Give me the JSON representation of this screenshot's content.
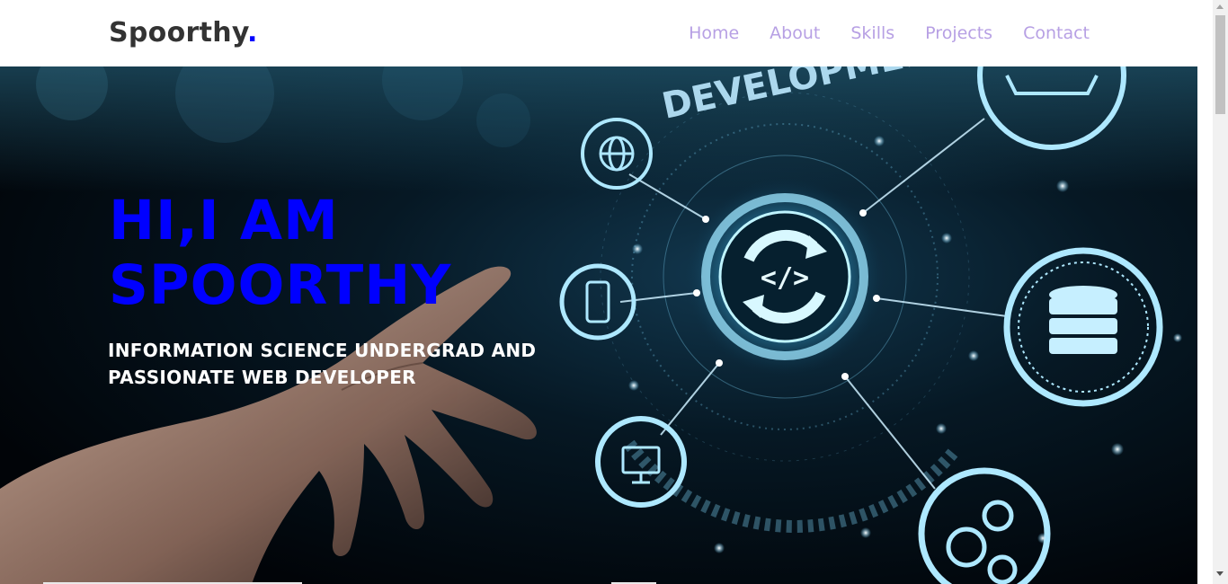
{
  "brand": {
    "name": "Spoorthy",
    "dot": "."
  },
  "nav": {
    "items": [
      {
        "label": "Home"
      },
      {
        "label": "About"
      },
      {
        "label": "Skills"
      },
      {
        "label": "Projects"
      },
      {
        "label": "Contact"
      }
    ]
  },
  "hero": {
    "title_line1": "HI,I AM",
    "title_line2": "SPOORTHY",
    "subtitle_line1": "INFORMATION SCIENCE UNDERGRAD AND",
    "subtitle_line2": "PASSIONATE WEB DEVELOPER",
    "background_text": "DEVELOPMENT"
  },
  "colors": {
    "brand_dot": "#0000ff",
    "nav_link": "#b7a0e4",
    "hero_title": "#0000ff",
    "hero_subtitle": "#ffffff",
    "glow": "#8fe0ff"
  }
}
